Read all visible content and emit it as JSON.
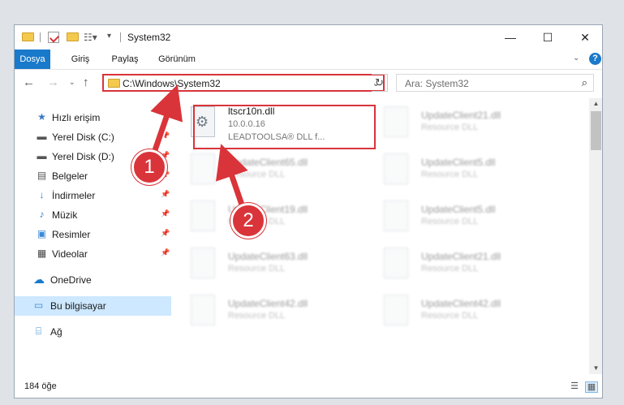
{
  "window": {
    "title": "System32",
    "controls": {
      "minimize": "—",
      "maximize": "☐",
      "close": "✕"
    }
  },
  "ribbon": {
    "tabs": [
      "Dosya",
      "Giriş",
      "Paylaş",
      "Görünüm"
    ]
  },
  "address": {
    "path": "C:\\Windows\\System32",
    "search_placeholder": "Ara: System32"
  },
  "nav_pane": {
    "items": [
      {
        "label": "Hızlı erişim",
        "icon": "star-icon"
      },
      {
        "label": "Yerel Disk (C:)",
        "icon": "drive-icon",
        "pinned": true
      },
      {
        "label": "Yerel Disk (D:)",
        "icon": "drive-icon",
        "pinned": true
      },
      {
        "label": "Belgeler",
        "icon": "documents-icon",
        "pinned": true
      },
      {
        "label": "İndirmeler",
        "icon": "download-icon",
        "pinned": true
      },
      {
        "label": "Müzik",
        "icon": "music-icon",
        "pinned": true
      },
      {
        "label": "Resimler",
        "icon": "pictures-icon",
        "pinned": true
      },
      {
        "label": "Videolar",
        "icon": "videos-icon",
        "pinned": true
      },
      {
        "label": "OneDrive",
        "icon": "cloud-icon"
      },
      {
        "label": "Bu bilgisayar",
        "icon": "computer-icon",
        "selected": true
      },
      {
        "label": "Ağ",
        "icon": "network-icon"
      }
    ]
  },
  "files": {
    "highlighted": {
      "name": "ltscr10n.dll",
      "version": "10.0.0.16",
      "desc": "LEADTOOLSA® DLL f..."
    },
    "col1": [
      {
        "name": "UpdateClient65.dll",
        "desc": "Resource DLL"
      },
      {
        "name": "UpdateClient19.dll",
        "desc": "Resource DLL"
      },
      {
        "name": "UpdateClient63.dll",
        "desc": "Resource DLL"
      },
      {
        "name": "UpdateClient42.dll",
        "desc": "Resource DLL"
      }
    ],
    "col2": [
      {
        "name": "UpdateClient21.dll",
        "desc": "Resource DLL"
      },
      {
        "name": "UpdateClient5.dll",
        "desc": "Resource DLL"
      },
      {
        "name": "UpdateClient5.dll",
        "desc": "Resource DLL"
      },
      {
        "name": "UpdateClient21.dll",
        "desc": "Resource DLL"
      },
      {
        "name": "UpdateClient42.dll",
        "desc": "Resource DLL"
      }
    ]
  },
  "status": {
    "count": "184 öğe"
  },
  "callouts": [
    "1",
    "2"
  ],
  "colors": {
    "accent": "#1979ca",
    "highlight": "#d9343a",
    "selection": "#cde8ff"
  }
}
